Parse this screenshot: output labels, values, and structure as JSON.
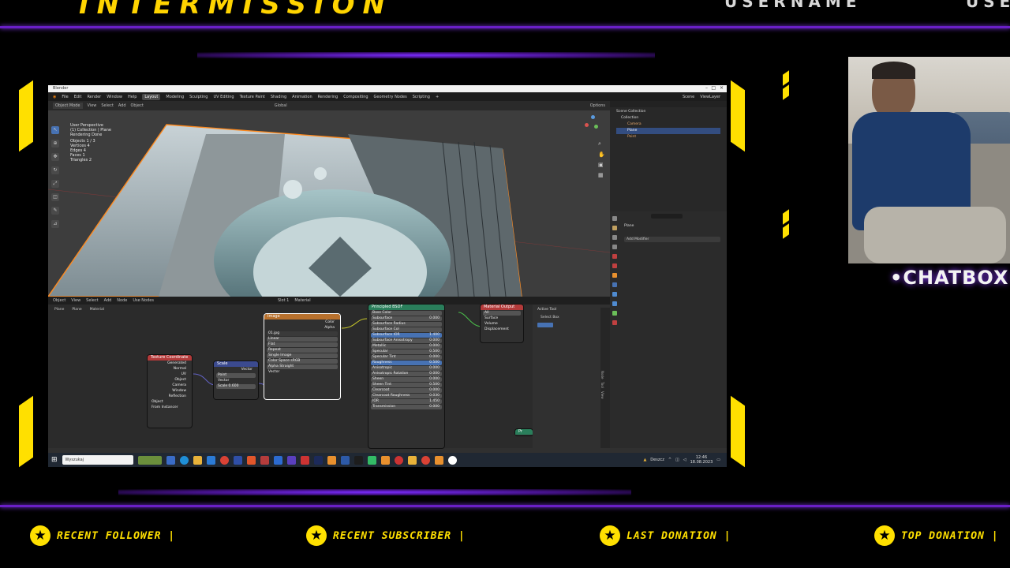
{
  "overlay": {
    "title": "INTERMISSION",
    "username_left": "USERNAME",
    "username_right": "USE",
    "chatbox": "•CHATBOX•",
    "accent_color": "#ffe000",
    "line_color": "#6a1fc7",
    "footer": [
      {
        "label": "RECENT FOLLOWER |"
      },
      {
        "label": "RECENT SUBSCRIBER |"
      },
      {
        "label": "LAST DONATION |"
      },
      {
        "label": "TOP DONATION |"
      }
    ],
    "star_icon": "★"
  },
  "blender": {
    "title": "Blender",
    "menu": [
      "File",
      "Edit",
      "Render",
      "Window",
      "Help"
    ],
    "workspaces": [
      "Layout",
      "Modeling",
      "Sculpting",
      "UV Editing",
      "Texture Paint",
      "Shading",
      "Animation",
      "Rendering",
      "Compositing",
      "Geometry Nodes",
      "Scripting"
    ],
    "active_workspace": "Layout",
    "scene": "Scene",
    "view_layer": "ViewLayer",
    "viewport_header": [
      "Object Mode",
      "View",
      "Select",
      "Add",
      "Object"
    ],
    "orientation": "Global",
    "options_label": "Options",
    "viewport_info": {
      "line1": "User Perspective",
      "line2": "(1) Collection | Plane",
      "line3": "Rendering Done",
      "stats": [
        {
          "k": "Objects",
          "v": "1 / 3"
        },
        {
          "k": "Vertices",
          "v": "4"
        },
        {
          "k": "Edges",
          "v": "4"
        },
        {
          "k": "Faces",
          "v": "1"
        },
        {
          "k": "Triangles",
          "v": "2"
        }
      ]
    },
    "outliner": {
      "root": "Scene Collection",
      "collection": "Collection",
      "items": [
        "Camera",
        "Plane",
        "Point"
      ]
    },
    "properties": {
      "object": "Plane",
      "add_modifier": "Add Modifier"
    },
    "node_header": [
      "Object",
      "View",
      "Select",
      "Add",
      "Node",
      "Use Nodes"
    ],
    "slot": "Slot 1",
    "material": "Material",
    "breadcrumb": [
      "Plane",
      "Plane",
      "Material"
    ],
    "nodes": {
      "texcoord": {
        "title": "Texture Coordinate",
        "outputs": [
          "Generated",
          "Normal",
          "UV",
          "Object",
          "Camera",
          "Window",
          "Reflection"
        ],
        "object_label": "Object",
        "from_instancer": "From Instancer"
      },
      "mapping": {
        "title": "Scale",
        "rows": [
          "Vector",
          "Point",
          "Vector",
          "Scale"
        ],
        "scale_value": "0.600"
      },
      "image": {
        "title": "Image",
        "outputs": [
          "Color",
          "Alpha"
        ],
        "file": "01.jpg",
        "rows": [
          "Linear",
          "Flat",
          "Repeat",
          "Single Image",
          "Color Space",
          "Alpha",
          "Vector"
        ],
        "color_space": "sRGB",
        "alpha_mode": "Straight"
      },
      "bsdf": {
        "title": "Principled BSDF",
        "rows": [
          {
            "label": "Base Color",
            "value": ""
          },
          {
            "label": "Subsurface",
            "value": "0.000"
          },
          {
            "label": "Subsurface Radius",
            "value": ""
          },
          {
            "label": "Subsurface Col",
            "value": ""
          },
          {
            "label": "Subsurface IOR",
            "value": "1.400"
          },
          {
            "label": "Subsurface Anisotropy",
            "value": "0.000"
          },
          {
            "label": "Metallic",
            "value": "0.000"
          },
          {
            "label": "Specular",
            "value": "0.500"
          },
          {
            "label": "Specular Tint",
            "value": "0.000"
          },
          {
            "label": "Roughness",
            "value": "0.500"
          },
          {
            "label": "Anisotropic",
            "value": "0.000"
          },
          {
            "label": "Anisotropic Rotation",
            "value": "0.000"
          },
          {
            "label": "Sheen",
            "value": "0.000"
          },
          {
            "label": "Sheen Tint",
            "value": "0.500"
          },
          {
            "label": "Clearcoat",
            "value": "0.000"
          },
          {
            "label": "Clearcoat Roughness",
            "value": "0.030"
          },
          {
            "label": "IOR",
            "value": "1.450"
          },
          {
            "label": "Transmission",
            "value": "0.000"
          }
        ]
      },
      "output": {
        "title": "Material Output",
        "target": "All",
        "rows": [
          "Surface",
          "Volume",
          "Displacement"
        ]
      },
      "principled_small": "Pr"
    },
    "active_tool": {
      "title": "Active Tool",
      "item": "Select Box"
    },
    "side_tabs": [
      "Node",
      "Tool",
      "View",
      "Options",
      "Node Wrangler"
    ],
    "taskbar": {
      "search": "Wyszukaj",
      "weather": "Deszcz",
      "time": "12:46",
      "date": "18.08.2023"
    }
  }
}
